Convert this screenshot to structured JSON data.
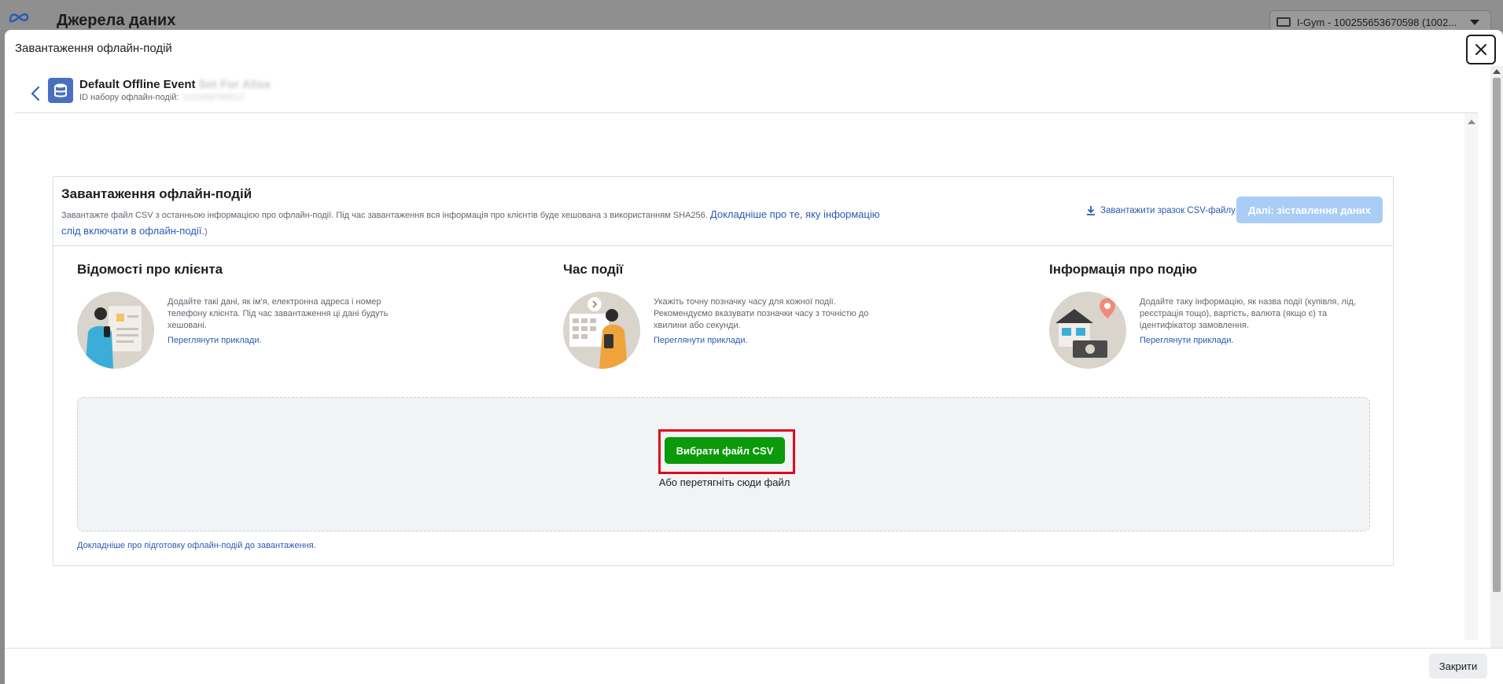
{
  "background": {
    "page_title": "Джерела даних",
    "account_label": "I-Gym - 100255653670598 (1002..."
  },
  "modal": {
    "title": "Завантаження офлайн-подій",
    "dataset": {
      "name": "Default Offline Event",
      "name_hidden": "Set For Alisa",
      "id_label": "ID набору офлайн-подій:",
      "id_hidden": "1123456789012"
    },
    "card": {
      "title": "Завантаження офлайн-подій",
      "description": "Завантажте файл CSV з останньою інформацією про офлайн-події. Під час завантаження вся інформація про клієнтів буде хешована з використанням SHA256.",
      "description_link": "Докладніше про те, яку інформацію слід включати в офлайн-події.",
      "description_tail": ")",
      "download_sample": "Завантажити зразок CSV-файлу",
      "next_button": "Далі: зіставлення даних",
      "columns": [
        {
          "title": "Відомості про клієнта",
          "text": "Додайте такі дані, як ім'я, електронна адреса і номер телефону клієнта. Під час завантаження ці дані будуть хешовані.",
          "link": "Переглянути приклади."
        },
        {
          "title": "Час події",
          "text": "Укажіть точну позначку часу для кожної події. Рекомендуємо вказувати позначки часу з точністю до хвилини або секунди.",
          "link": "Переглянути приклади."
        },
        {
          "title": "Інформація про подію",
          "text": "Додайте таку інформацію, як назва події (купівля, лід, реєстрація тощо), вартість, валюта (якщо є) та ідентифікатор замовлення.",
          "link": "Переглянути приклади."
        }
      ],
      "choose_file_button": "Вибрати файл CSV",
      "drop_hint": "Або перетягніть сюди файл",
      "prep_link": "Докладніше про підготовку офлайн-подій до завантаження."
    },
    "footer": {
      "close_button": "Закрити"
    }
  },
  "colors": {
    "primary_green": "#0a9a0a",
    "link_blue": "#2a5bb5",
    "disabled_blue": "#a9cdf6",
    "highlight_red": "#e0081c"
  }
}
